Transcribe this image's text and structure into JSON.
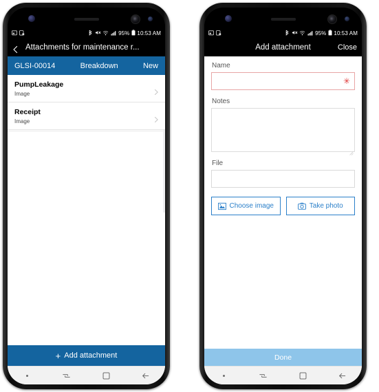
{
  "status_bar": {
    "notification_icons": [
      "screenshot-icon",
      "screenshot-saved-icon"
    ],
    "bluetooth_icon": "bluetooth-icon",
    "mute_icon": "sound-muted-icon",
    "wifi_icon": "wifi-icon",
    "signal_icon": "cellular-signal-icon",
    "battery_percent": "95%",
    "battery_icon": "battery-icon",
    "time": "10:53 AM"
  },
  "left_phone": {
    "title_bar": {
      "back_icon": "back-chevron-icon",
      "title": "Attachments for maintenance r..."
    },
    "record_banner": {
      "id": "GLSI-00014",
      "type": "Breakdown",
      "status": "New"
    },
    "attachments": [
      {
        "name": "PumpLeakage",
        "type": "Image",
        "chevron": "chevron-right-icon"
      },
      {
        "name": "Receipt",
        "type": "Image",
        "chevron": "chevron-right-icon"
      }
    ],
    "action_button": {
      "plus": "+",
      "label": "Add attachment"
    }
  },
  "right_phone": {
    "title_bar": {
      "title": "Add attachment",
      "close_label": "Close"
    },
    "fields": {
      "name_label": "Name",
      "name_value": "",
      "name_required_marker": "✳",
      "notes_label": "Notes",
      "notes_value": "",
      "file_label": "File",
      "file_value": ""
    },
    "buttons": {
      "choose_image": {
        "label": "Choose image",
        "icon": "picture-icon"
      },
      "take_photo": {
        "label": "Take photo",
        "icon": "camera-icon"
      }
    },
    "done_button": {
      "label": "Done"
    }
  },
  "nav_bar": {
    "dot": "status-dot-icon",
    "recents": "recents-icon",
    "home": "home-square-icon",
    "back": "back-arrow-icon"
  },
  "colors": {
    "banner_blue": "#14649f",
    "accent_blue": "#2a7fc9",
    "done_disabled_blue": "#8ec5ea",
    "required_red": "#e03b3b"
  }
}
